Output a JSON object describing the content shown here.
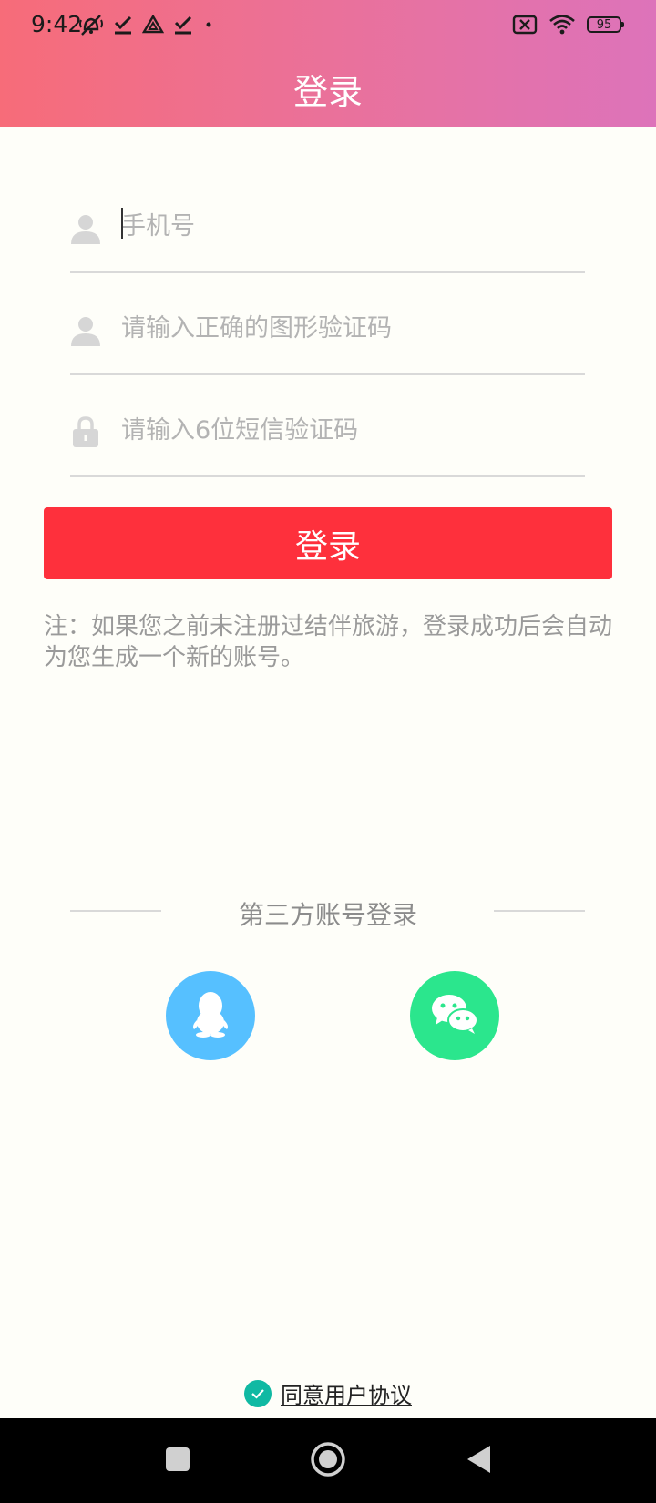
{
  "status_bar": {
    "time": "9:42",
    "battery": "95",
    "icons_left": [
      "silent-alarm-icon",
      "check-download-icon",
      "drive-icon",
      "check-download-icon",
      "dot-icon"
    ],
    "icons_right": [
      "sim-off-icon",
      "wifi-icon",
      "battery-icon"
    ]
  },
  "header": {
    "title": "登录",
    "gradient_start": "#f76c79",
    "gradient_end": "#dd73ba"
  },
  "form": {
    "phone_placeholder": "手机号",
    "captcha_placeholder": "请输入正确的图形验证码",
    "sms_placeholder": "请输入6位短信验证码",
    "login_label": "登录",
    "login_color": "#fe303c"
  },
  "note": "注：如果您之前未注册过结伴旅游，登录成功后会自动为您生成一个新的账号。",
  "third_party": {
    "label": "第三方账号登录",
    "qq_color": "#56c0ff",
    "wechat_color": "#2be68d"
  },
  "agreement": {
    "label": "同意用户协议",
    "checked": true,
    "check_color": "#10b9a3"
  },
  "nav_bar": {
    "buttons": [
      "recent-apps-icon",
      "home-icon",
      "back-icon"
    ]
  }
}
